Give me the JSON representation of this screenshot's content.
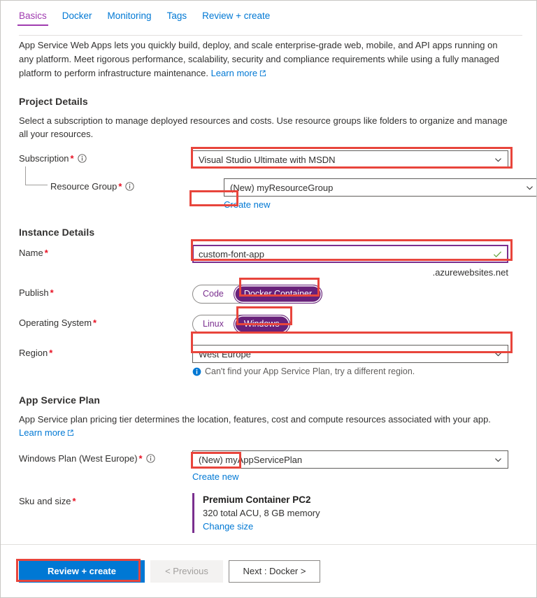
{
  "tabs": [
    {
      "label": "Basics",
      "active": true
    },
    {
      "label": "Docker",
      "active": false
    },
    {
      "label": "Monitoring",
      "active": false
    },
    {
      "label": "Tags",
      "active": false
    },
    {
      "label": "Review + create",
      "active": false
    }
  ],
  "intro": {
    "text": "App Service Web Apps lets you quickly build, deploy, and scale enterprise-grade web, mobile, and API apps running on any platform. Meet rigorous performance, scalability, security and compliance requirements while using a fully managed platform to perform infrastructure maintenance.",
    "learn_more": "Learn more"
  },
  "project_details": {
    "heading": "Project Details",
    "description": "Select a subscription to manage deployed resources and costs. Use resource groups like folders to organize and manage all your resources.",
    "subscription": {
      "label": "Subscription",
      "required": "*",
      "value": "Visual Studio Ultimate with MSDN"
    },
    "resource_group": {
      "label": "Resource Group",
      "required": "*",
      "value": "(New) myResourceGroup",
      "create_new": "Create new"
    }
  },
  "instance_details": {
    "heading": "Instance Details",
    "name": {
      "label": "Name",
      "required": "*",
      "value": "custom-font-app",
      "suffix": ".azurewebsites.net",
      "valid": true
    },
    "publish": {
      "label": "Publish",
      "required": "*",
      "options": [
        "Code",
        "Docker Container"
      ],
      "selected": "Docker Container"
    },
    "operating_system": {
      "label": "Operating System",
      "required": "*",
      "options": [
        "Linux",
        "Windows"
      ],
      "selected": "Windows"
    },
    "region": {
      "label": "Region",
      "required": "*",
      "value": "West Europe",
      "hint": "Can't find your App Service Plan, try a different region."
    }
  },
  "app_service_plan": {
    "heading": "App Service Plan",
    "description": "App Service plan pricing tier determines the location, features, cost and compute resources associated with your app.",
    "learn_more": "Learn more",
    "plan": {
      "label": "Windows Plan (West Europe)",
      "required": "*",
      "value": "(New) myAppServicePlan",
      "create_new": "Create new"
    },
    "sku": {
      "label": "Sku and size",
      "required": "*",
      "title": "Premium Container PC2",
      "subtitle": "320 total ACU, 8 GB memory",
      "change_link": "Change size"
    }
  },
  "footer": {
    "review_create": "Review + create",
    "previous": "< Previous",
    "next": "Next : Docker >"
  },
  "colors": {
    "accent_blue": "#0078d4",
    "accent_purple": "#68217a",
    "required_red": "#e81123",
    "highlight_red": "#e8453c",
    "valid_green": "#6ba644"
  }
}
